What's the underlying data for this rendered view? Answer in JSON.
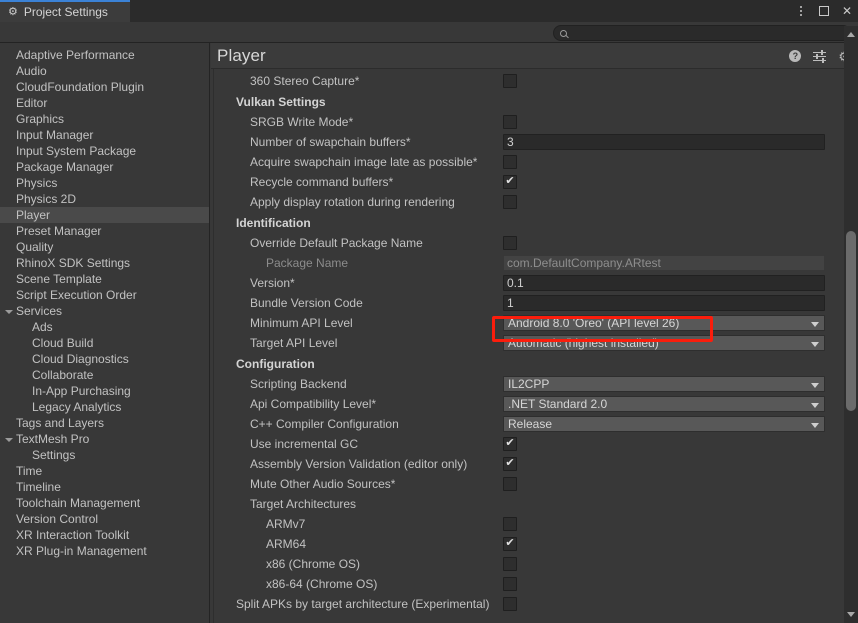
{
  "window": {
    "tab_label": "Project Settings",
    "tab_icon": "gear-icon",
    "controls": {
      "menu": "kebab-menu-icon",
      "maximize": "maximize-icon",
      "close": "✕"
    }
  },
  "search": {
    "value": "",
    "placeholder": "",
    "icon": "search-icon"
  },
  "sidebar": {
    "items": [
      {
        "label": "Adaptive Performance",
        "level": 0,
        "selected": false
      },
      {
        "label": "Audio",
        "level": 0,
        "selected": false
      },
      {
        "label": "CloudFoundation Plugin",
        "level": 0,
        "selected": false
      },
      {
        "label": "Editor",
        "level": 0,
        "selected": false
      },
      {
        "label": "Graphics",
        "level": 0,
        "selected": false
      },
      {
        "label": "Input Manager",
        "level": 0,
        "selected": false
      },
      {
        "label": "Input System Package",
        "level": 0,
        "selected": false
      },
      {
        "label": "Package Manager",
        "level": 0,
        "selected": false
      },
      {
        "label": "Physics",
        "level": 0,
        "selected": false
      },
      {
        "label": "Physics 2D",
        "level": 0,
        "selected": false
      },
      {
        "label": "Player",
        "level": 0,
        "selected": true
      },
      {
        "label": "Preset Manager",
        "level": 0,
        "selected": false
      },
      {
        "label": "Quality",
        "level": 0,
        "selected": false
      },
      {
        "label": "RhinoX SDK Settings",
        "level": 0,
        "selected": false
      },
      {
        "label": "Scene Template",
        "level": 0,
        "selected": false
      },
      {
        "label": "Script Execution Order",
        "level": 0,
        "selected": false
      },
      {
        "label": "Services",
        "level": 0,
        "selected": false,
        "expanded": true
      },
      {
        "label": "Ads",
        "level": 1,
        "selected": false
      },
      {
        "label": "Cloud Build",
        "level": 1,
        "selected": false
      },
      {
        "label": "Cloud Diagnostics",
        "level": 1,
        "selected": false
      },
      {
        "label": "Collaborate",
        "level": 1,
        "selected": false
      },
      {
        "label": "In-App Purchasing",
        "level": 1,
        "selected": false
      },
      {
        "label": "Legacy Analytics",
        "level": 1,
        "selected": false
      },
      {
        "label": "Tags and Layers",
        "level": 0,
        "selected": false
      },
      {
        "label": "TextMesh Pro",
        "level": 0,
        "selected": false,
        "expanded": true
      },
      {
        "label": "Settings",
        "level": 1,
        "selected": false
      },
      {
        "label": "Time",
        "level": 0,
        "selected": false
      },
      {
        "label": "Timeline",
        "level": 0,
        "selected": false
      },
      {
        "label": "Toolchain Management",
        "level": 0,
        "selected": false
      },
      {
        "label": "Version Control",
        "level": 0,
        "selected": false
      },
      {
        "label": "XR Interaction Toolkit",
        "level": 0,
        "selected": false
      },
      {
        "label": "XR Plug-in Management",
        "level": 0,
        "selected": false
      }
    ]
  },
  "main": {
    "title": "Player",
    "header_icons": [
      {
        "name": "help-icon",
        "glyph": "?"
      },
      {
        "name": "preset-icon",
        "glyph": ""
      },
      {
        "name": "gear-icon",
        "glyph": "⚙"
      }
    ],
    "rows": [
      {
        "kind": "checkbox",
        "label": "360 Stereo Capture*",
        "indent": 1,
        "checked": false
      },
      {
        "kind": "section",
        "label": "Vulkan Settings"
      },
      {
        "kind": "checkbox",
        "label": "SRGB Write Mode*",
        "indent": 1,
        "checked": false
      },
      {
        "kind": "text",
        "label": "Number of swapchain buffers*",
        "indent": 1,
        "value": "3"
      },
      {
        "kind": "checkbox",
        "label": "Acquire swapchain image late as possible*",
        "indent": 1,
        "checked": false
      },
      {
        "kind": "checkbox",
        "label": "Recycle command buffers*",
        "indent": 1,
        "checked": true
      },
      {
        "kind": "checkbox",
        "label": "Apply display rotation during rendering",
        "indent": 1,
        "checked": false
      },
      {
        "kind": "section",
        "label": "Identification"
      },
      {
        "kind": "checkbox",
        "label": "Override Default Package Name",
        "indent": 1,
        "checked": false
      },
      {
        "kind": "text",
        "label": "Package Name",
        "indent": 2,
        "value": "com.DefaultCompany.ARtest",
        "disabled": true
      },
      {
        "kind": "text",
        "label": "Version*",
        "indent": 1,
        "value": "0.1"
      },
      {
        "kind": "text",
        "label": "Bundle Version Code",
        "indent": 1,
        "value": "1"
      },
      {
        "kind": "dropdown",
        "label": "Minimum API Level",
        "indent": 1,
        "value": "Android 8.0 'Oreo' (API level 26)",
        "highlighted": true
      },
      {
        "kind": "dropdown",
        "label": "Target API Level",
        "indent": 1,
        "value": "Automatic (highest installed)"
      },
      {
        "kind": "section",
        "label": "Configuration"
      },
      {
        "kind": "dropdown",
        "label": "Scripting Backend",
        "indent": 1,
        "value": "IL2CPP"
      },
      {
        "kind": "dropdown",
        "label": "Api Compatibility Level*",
        "indent": 1,
        "value": ".NET Standard 2.0"
      },
      {
        "kind": "dropdown",
        "label": "C++ Compiler Configuration",
        "indent": 1,
        "value": "Release"
      },
      {
        "kind": "checkbox",
        "label": "Use incremental GC",
        "indent": 1,
        "checked": true
      },
      {
        "kind": "checkbox",
        "label": "Assembly Version Validation (editor only)",
        "indent": 1,
        "checked": true
      },
      {
        "kind": "checkbox",
        "label": "Mute Other Audio Sources*",
        "indent": 1,
        "checked": false
      },
      {
        "kind": "plain",
        "label": "Target Architectures",
        "indent": 1
      },
      {
        "kind": "checkbox",
        "label": "ARMv7",
        "indent": 2,
        "checked": false
      },
      {
        "kind": "checkbox",
        "label": "ARM64",
        "indent": 2,
        "checked": true
      },
      {
        "kind": "checkbox",
        "label": "x86 (Chrome OS)",
        "indent": 2,
        "checked": false
      },
      {
        "kind": "checkbox",
        "label": "x86-64 (Chrome OS)",
        "indent": 2,
        "checked": false
      },
      {
        "kind": "checkbox",
        "label": "Split APKs by target architecture (Experimental)",
        "indent": 0,
        "checked": false
      }
    ]
  },
  "colors": {
    "background": "#383838",
    "panel": "#3b3b3b",
    "accent": "#3b82d6",
    "highlight_box": "#fb1d0c",
    "selection": "#4a4a4a",
    "dropdown": "#585858",
    "field": "#2a2a2a"
  }
}
